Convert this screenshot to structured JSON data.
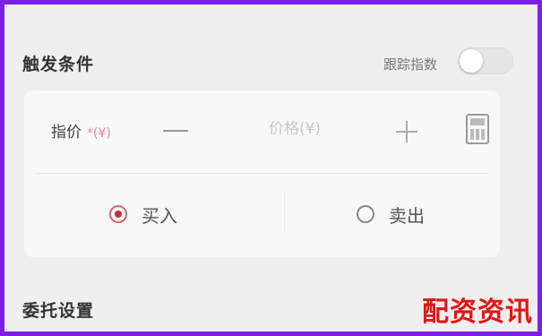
{
  "trigger_section": {
    "title": "触发条件",
    "track_label": "跟踪指数",
    "track_toggle_on": false
  },
  "card": {
    "price_label": "指价",
    "price_required_mark": "*",
    "price_unit": "(¥)",
    "price_placeholder": "价格(¥)",
    "price_value": "",
    "direction_options": [
      {
        "label": "买入",
        "selected": true
      },
      {
        "label": "卖出",
        "selected": false
      }
    ]
  },
  "delegate_section": {
    "title": "委托设置"
  },
  "watermark": "配资资讯"
}
